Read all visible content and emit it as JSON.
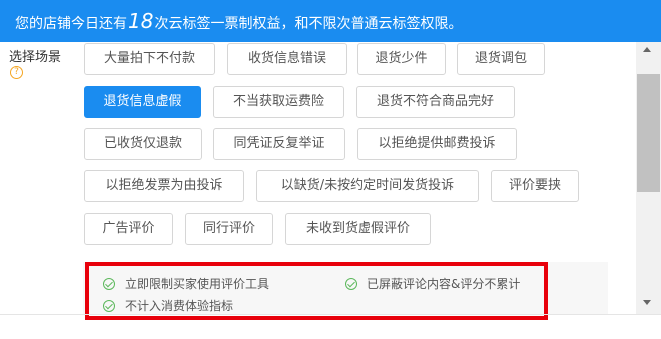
{
  "banner": {
    "prefix": "您的店铺今日还有",
    "count": "18",
    "suffix": "次云标签一票制权益，和不限次普通云标签权限。"
  },
  "scene": {
    "label": "选择场景",
    "help_symbol": "?"
  },
  "options": [
    "大量拍下不付款",
    "收货信息错误",
    "退货少件",
    "退货调包",
    "退货信息虚假",
    "不当获取运费险",
    "退货不符合商品完好",
    "已收货仅退款",
    "同凭证反复举证",
    "以拒绝提供邮费投诉",
    "以拒绝发票为由投诉",
    "以缺货/未按约定时间发货投诉",
    "评价要挟",
    "广告评价",
    "同行评价",
    "未收到货虚假评价"
  ],
  "selected_option": "退货信息虚假",
  "effects": [
    "立即限制买家使用评价工具",
    "已屏蔽评论内容&评分不累计",
    "不计入消费体验指标"
  ],
  "colors": {
    "banner_bg": "#1a8cf0",
    "selected_bg": "#1a8cf0",
    "highlight_border": "#e8000b",
    "check_green": "#5cb85c",
    "help_orange": "#f5a623"
  }
}
